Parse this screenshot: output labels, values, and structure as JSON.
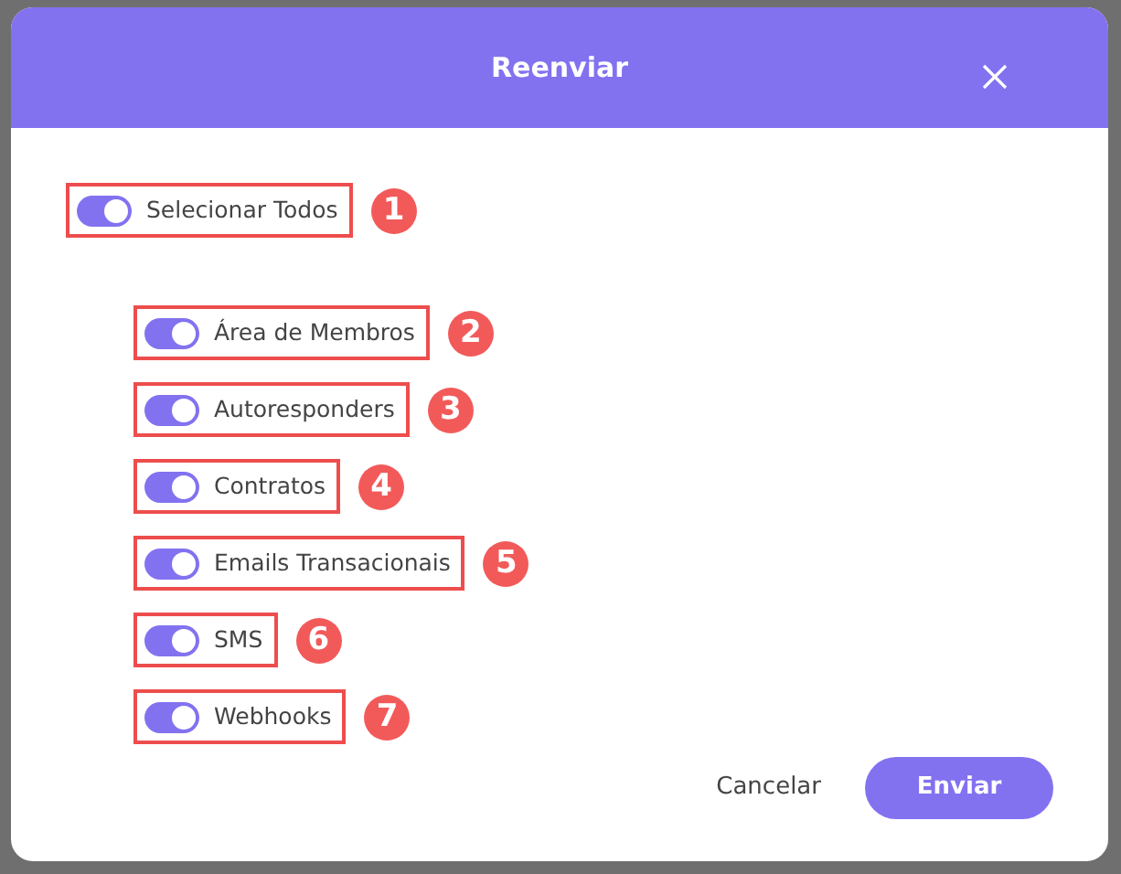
{
  "dialog": {
    "title": "Reenviar",
    "select_all": {
      "label": "Selecionar Todos",
      "on": true,
      "marker": "1"
    },
    "options": [
      {
        "label": "Área de Membros",
        "on": true,
        "marker": "2"
      },
      {
        "label": "Autoresponders",
        "on": true,
        "marker": "3"
      },
      {
        "label": "Contratos",
        "on": true,
        "marker": "4"
      },
      {
        "label": "Emails Transacionais",
        "on": true,
        "marker": "5"
      },
      {
        "label": "SMS",
        "on": true,
        "marker": "6"
      },
      {
        "label": "Webhooks",
        "on": true,
        "marker": "7"
      }
    ],
    "buttons": [
      {
        "label": "Cancelar",
        "kind": "link"
      },
      {
        "label": "Enviar",
        "kind": "primary"
      }
    ]
  }
}
